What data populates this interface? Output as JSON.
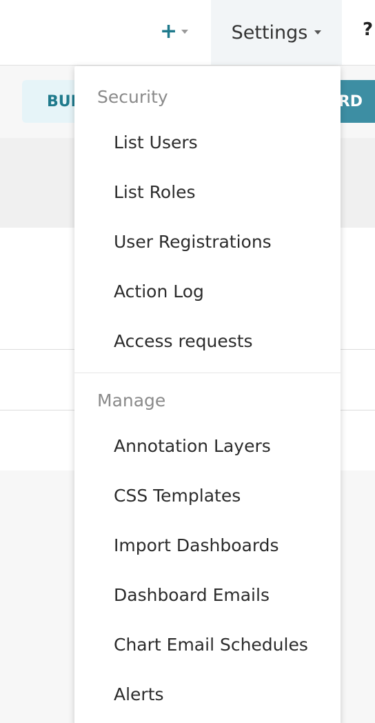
{
  "navbar": {
    "plus_symbol": "+",
    "settings_label": "Settings",
    "help_symbol": "?"
  },
  "background": {
    "bulk_button": "BUL",
    "dashboard_button": "RD"
  },
  "dropdown": {
    "sections": [
      {
        "header": "Security",
        "items": [
          "List Users",
          "List Roles",
          "User Registrations",
          "Action Log",
          "Access requests"
        ]
      },
      {
        "header": "Manage",
        "items": [
          "Annotation Layers",
          "CSS Templates",
          "Import Dashboards",
          "Dashboard Emails",
          "Chart Email Schedules",
          "Alerts"
        ]
      }
    ]
  },
  "colors": {
    "accent": "#1f7a8c",
    "primary_button": "#3d8ea3",
    "secondary_button_bg": "#e6f4f8"
  }
}
